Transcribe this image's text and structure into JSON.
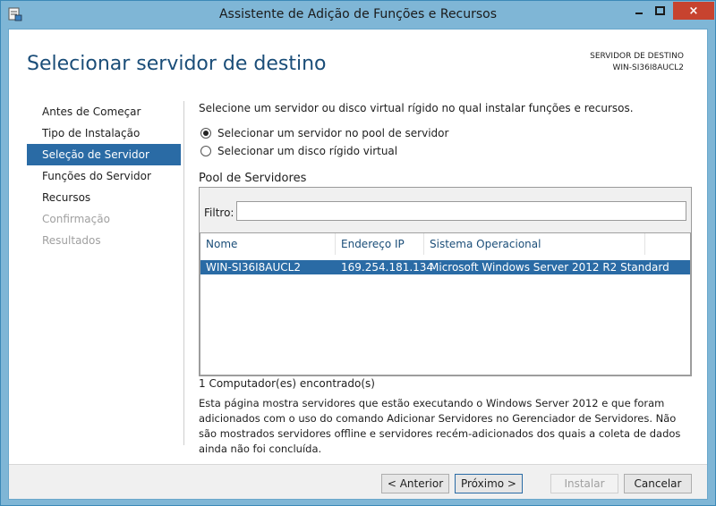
{
  "window": {
    "title": "Assistente de Adição de Funções e Recursos",
    "close_glyph": "×"
  },
  "header": {
    "page_title": "Selecionar servidor de destino",
    "destination_label": "SERVIDOR DE DESTINO",
    "destination_server": "WIN-SI36I8AUCL2"
  },
  "nav": {
    "items": [
      {
        "label": "Antes de Começar",
        "state": "normal"
      },
      {
        "label": "Tipo de Instalação",
        "state": "normal"
      },
      {
        "label": "Seleção de Servidor",
        "state": "active"
      },
      {
        "label": "Funções do Servidor",
        "state": "normal"
      },
      {
        "label": "Recursos",
        "state": "normal"
      },
      {
        "label": "Confirmação",
        "state": "disabled"
      },
      {
        "label": "Resultados",
        "state": "disabled"
      }
    ]
  },
  "main": {
    "intro": "Selecione um servidor ou disco virtual rígido no qual instalar funções e recursos.",
    "options": [
      {
        "label": "Selecionar um servidor no pool de servidor",
        "checked": true
      },
      {
        "label": "Selecionar um disco rígido virtual",
        "checked": false
      }
    ],
    "pool_title": "Pool de Servidores",
    "filter_label": "Filtro:",
    "filter_value": "",
    "columns": [
      "Nome",
      "Endereço IP",
      "Sistema Operacional"
    ],
    "rows": [
      {
        "name": "WIN-SI36I8AUCL2",
        "ip": "169.254.181.134",
        "os": "Microsoft Windows Server 2012 R2 Standard"
      }
    ],
    "found_text": "1 Computador(es) encontrado(s)",
    "description": "Esta página mostra servidores que estão executando o Windows Server 2012 e que foram adicionados com o uso do comando Adicionar Servidores no Gerenciador de Servidores. Não são mostrados servidores offline e servidores recém-adicionados dos quais a coleta de dados ainda não foi concluída."
  },
  "footer": {
    "previous_label": "< Anterior",
    "next_label": "Próximo >",
    "install_label": "Instalar",
    "cancel_label": "Cancelar"
  },
  "colors": {
    "frame": "#7fb6d6",
    "accent": "#2a6ba5",
    "title_text": "#1a4d78",
    "close": "#c7432f"
  }
}
